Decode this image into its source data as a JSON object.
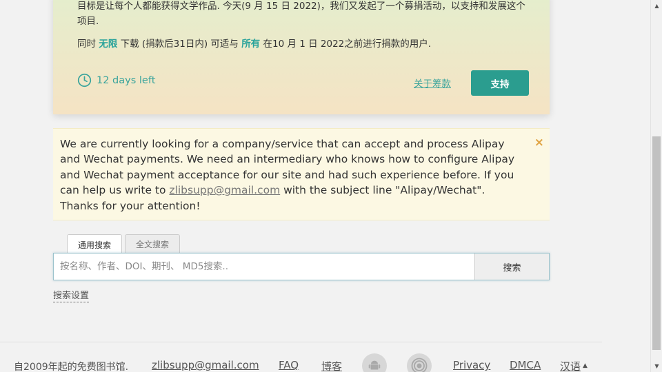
{
  "donation": {
    "paragraph1": "目标是让每个人都能获得文学作品. 今天(9 月 15 日 2022)，我们又发起了一个募捐活动，以支持和发展这个项目.",
    "p2_prefix": "同时 ",
    "p2_unlimited": "无限",
    "p2_middle": " 下载 (捐款后31日内) 可适与 ",
    "p2_all": "所有",
    "p2_suffix": " 在10 月 1 日 2022之前进行捐款的用户.",
    "days_left": "12 days left",
    "about_link": "关于筹款",
    "support_button": "支持",
    "accent_color": "#2b9d8f"
  },
  "notice": {
    "text_before": "We are currently looking for a company/service that can accept and process Alipay and Wechat payments. We need an intermediary who knows how to configure Alipay and Wechat payment acceptance for our site and had such experience before. If you can help us write to ",
    "email": "zlibsupp@gmail.com",
    "text_after": " with the subject line \"Alipay/Wechat\".",
    "thanks": "Thanks for your attention!",
    "close_icon": "×"
  },
  "search": {
    "tabs": [
      {
        "label": "通用搜索",
        "active": true
      },
      {
        "label": "全文搜索",
        "active": false
      }
    ],
    "placeholder": "按名称、作者、DOI、期刊、 MD5搜索..",
    "value": "",
    "button": "搜索",
    "settings_link": "搜索设置"
  },
  "footer": {
    "copyright": "自2009年起的免费图书馆.",
    "email": "zlibsupp@gmail.com",
    "faq": "FAQ",
    "blog": "博客",
    "android_icon": "android-icon",
    "tor_icon": "tor-icon",
    "privacy": "Privacy",
    "dmca": "DMCA",
    "language": "汉语",
    "language_caret": "▲"
  }
}
